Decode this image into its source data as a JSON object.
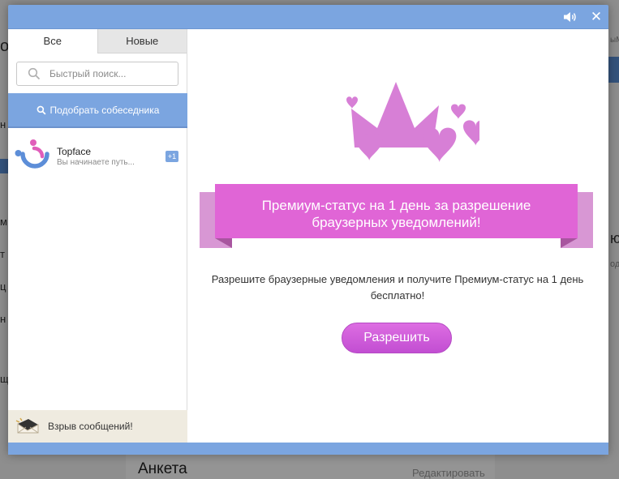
{
  "background": {
    "profile_heading": "Анкета",
    "edit_link": "Редактировать"
  },
  "window": {
    "sound_icon": "speaker-icon",
    "close_glyph": "✕"
  },
  "sidebar": {
    "tabs": [
      {
        "label": "Все",
        "active": true
      },
      {
        "label": "Новые",
        "active": false
      }
    ],
    "search": {
      "placeholder": "Быстрый поиск..."
    },
    "match_button": "Подобрать собеседника",
    "contacts": [
      {
        "name": "Topface",
        "preview": "Вы начинаете путь...",
        "badge": "+1"
      }
    ],
    "footer": "Взрыв сообщений!"
  },
  "promo": {
    "ribbon_text": "Премиум-статус на 1 день за разрешение браузерных уведомлений!",
    "description": "Разрешите браузерные уведомления и получите Премиум-статус на 1 день бесплатно!",
    "allow_button": "Разрешить"
  },
  "colors": {
    "frame_blue": "#7ba5e0",
    "accent_pink": "#d97fd9",
    "ribbon_pink": "#e065d6",
    "button_purple": "#c24ed2"
  }
}
